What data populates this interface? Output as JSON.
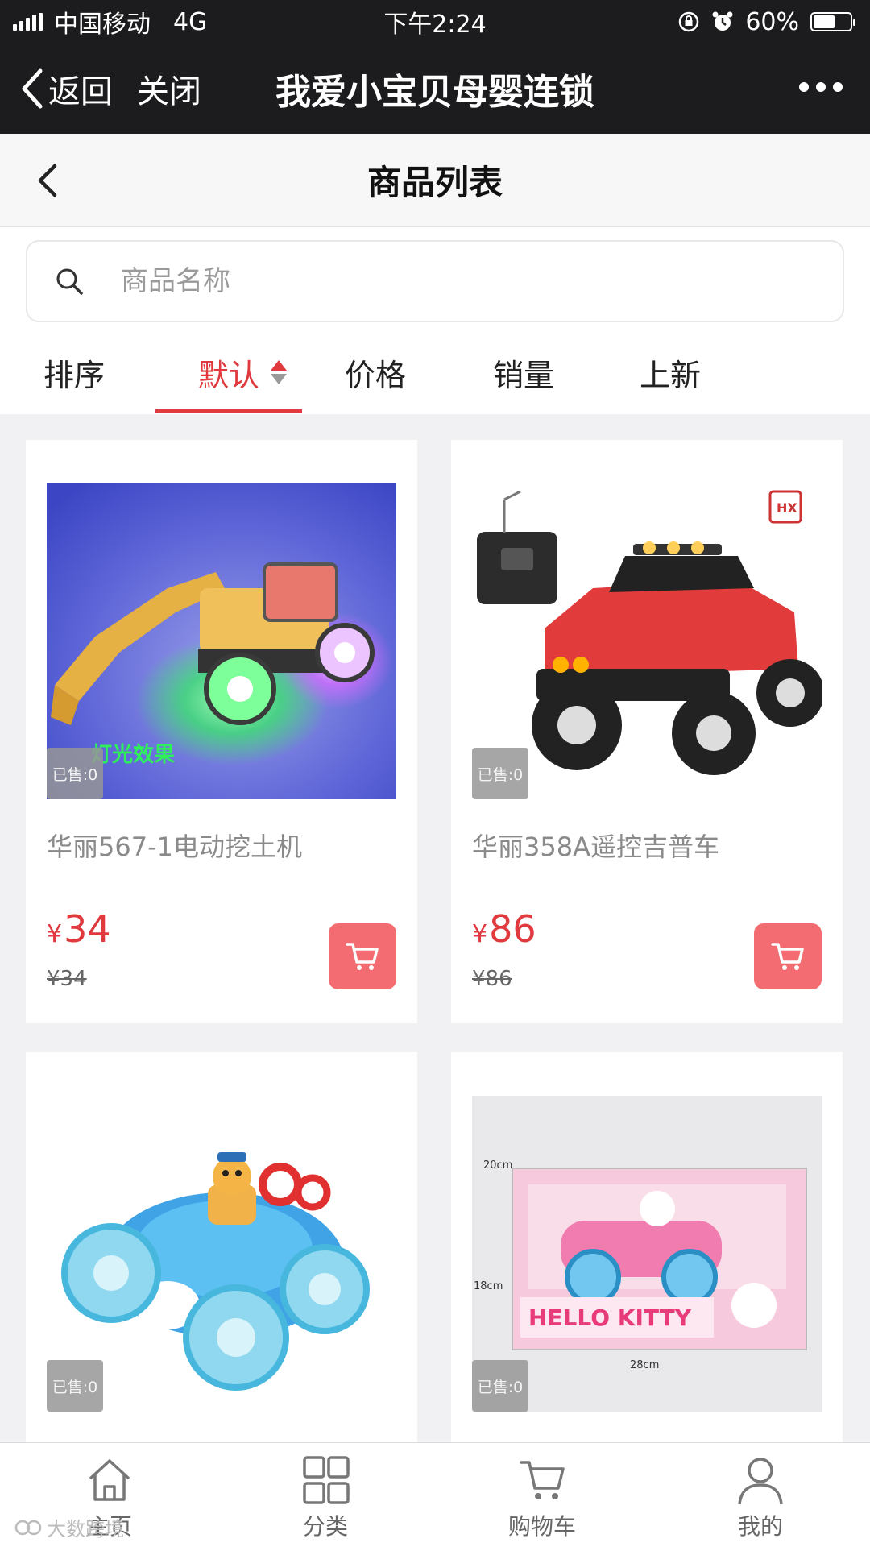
{
  "status_bar": {
    "carrier": "中国移动",
    "network": "4G",
    "time": "下午2:24",
    "battery": "60%",
    "battery_level": 0.6
  },
  "wechat_nav": {
    "back_label": "返回",
    "close_label": "关闭",
    "title": "我爱小宝贝母婴连锁"
  },
  "page_header": {
    "title": "商品列表"
  },
  "search": {
    "placeholder": "商品名称"
  },
  "sort": {
    "label": "排序",
    "options": [
      {
        "label": "默认",
        "active": true
      },
      {
        "label": "价格",
        "active": false
      },
      {
        "label": "销量",
        "active": false
      },
      {
        "label": "上新",
        "active": false
      }
    ]
  },
  "products": [
    {
      "name": "华丽567-1电动挖土机",
      "sold": "已售:0",
      "currency": "¥",
      "price": "34",
      "original_price": "¥34",
      "image_caption": "灯光效果"
    },
    {
      "name": "华丽358A遥控吉普车",
      "sold": "已售:0",
      "currency": "¥",
      "price": "86",
      "original_price": "¥86"
    },
    {
      "name": "",
      "sold": "已售:0"
    },
    {
      "name": "",
      "sold": "已售:0",
      "box_text": "HELLO KITTY"
    }
  ],
  "tab_bar": {
    "items": [
      {
        "label": "主页",
        "icon": "home-icon"
      },
      {
        "label": "分类",
        "icon": "grid-icon"
      },
      {
        "label": "购物车",
        "icon": "cart-icon"
      },
      {
        "label": "我的",
        "icon": "user-icon"
      }
    ]
  },
  "watermark": "大数跨境",
  "colors": {
    "accent": "#e0393e",
    "cart_button": "#f36c72",
    "nav_bg": "#1c1c1e"
  }
}
